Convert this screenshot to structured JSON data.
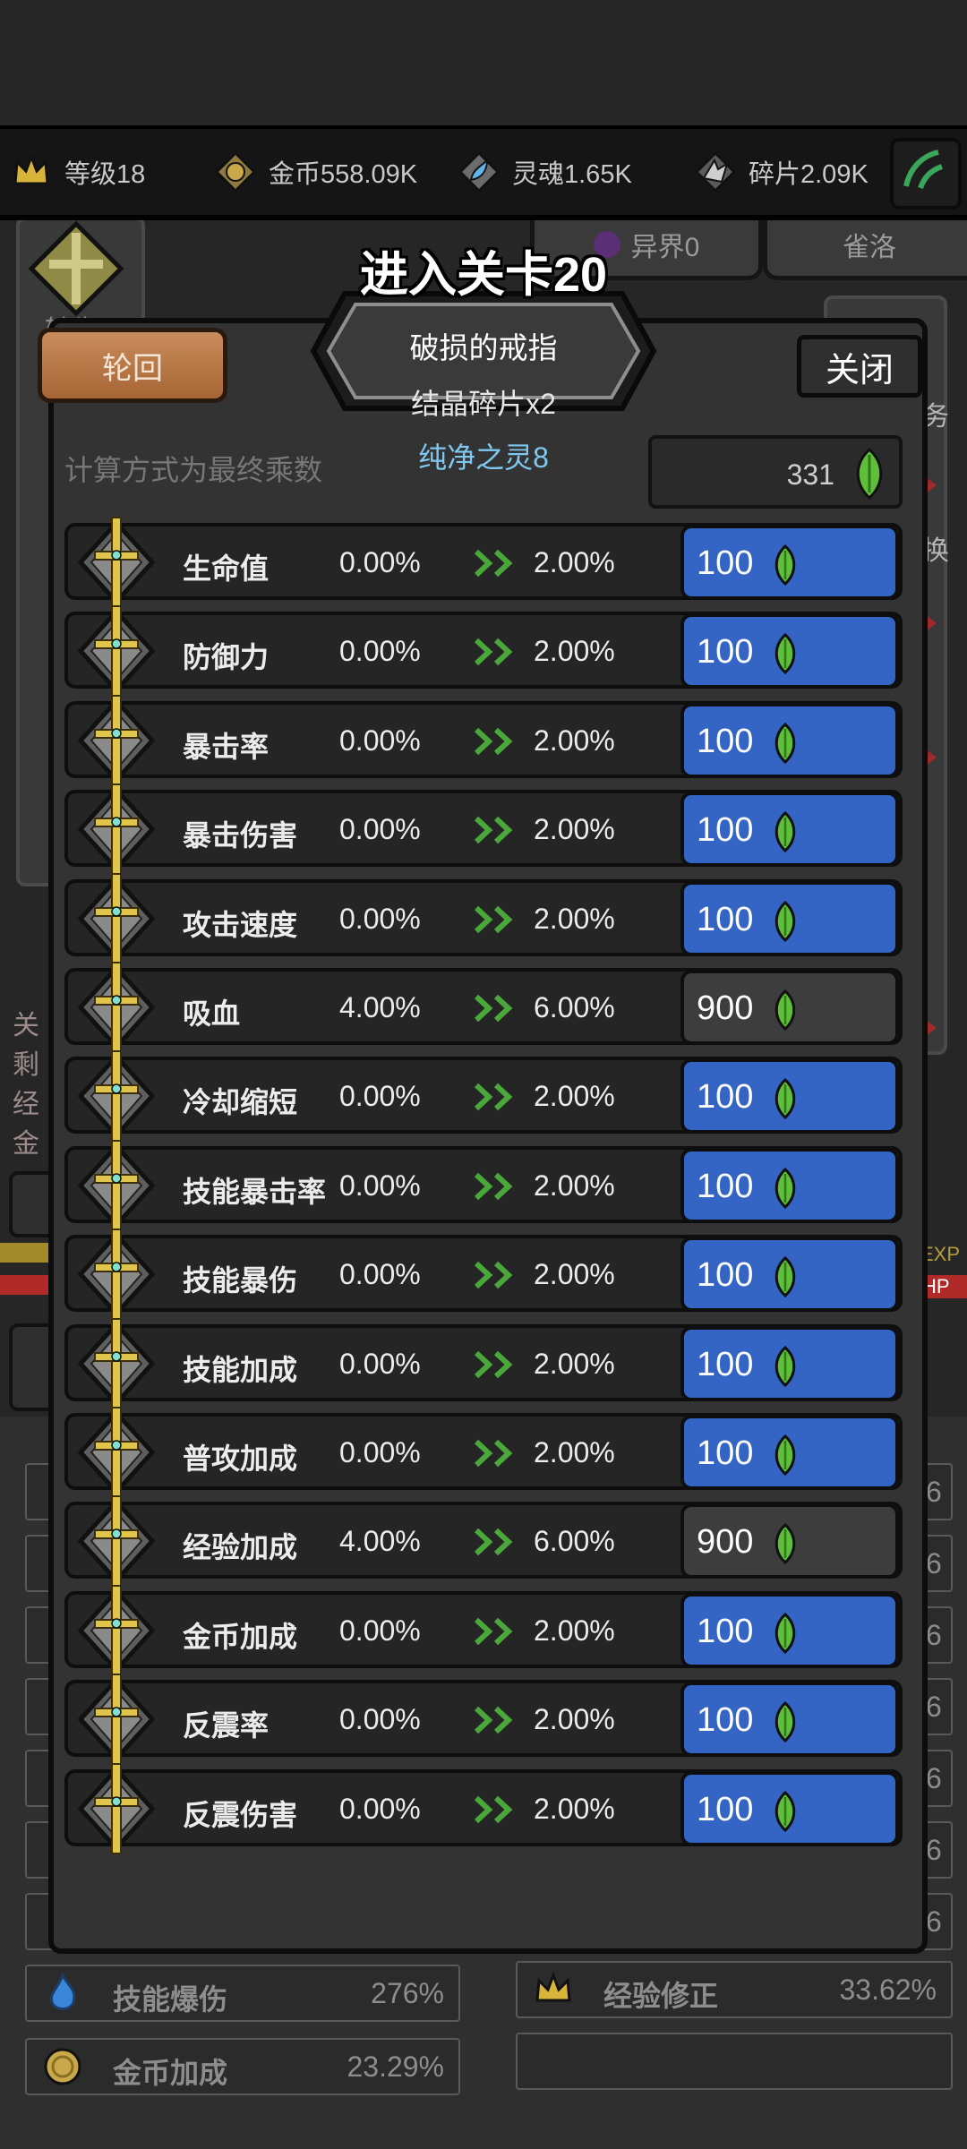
{
  "resources": [
    {
      "icon": "crown-icon",
      "label": "等级18"
    },
    {
      "icon": "gold-coin-icon",
      "label": "金币558.09K"
    },
    {
      "icon": "soul-icon",
      "label": "灵魂1.65K"
    },
    {
      "icon": "fragment-icon",
      "label": "碎片2.09K"
    }
  ],
  "background": {
    "tab_other_world": "异界0",
    "tab_right": "雀洛",
    "side_right_1": "务",
    "side_right_2": "换",
    "left_partial": [
      "关",
      "剩",
      "经",
      "金"
    ],
    "left_top_label": "转生",
    "exp_tag": "EXP",
    "hp_tag": "HP"
  },
  "modal": {
    "title": "进入关卡20",
    "item_name": "破损的戒指",
    "item_sub": "结晶碎片x2",
    "item_spirit": "纯净之灵8",
    "cycle_button": "轮回",
    "close_button": "关闭",
    "calc_hint": "计算方式为最终乘数",
    "balance": "331",
    "rows": [
      {
        "label": "生命值",
        "current": "0.00%",
        "next": "2.00%",
        "cost": "100",
        "state": "blue"
      },
      {
        "label": "防御力",
        "current": "0.00%",
        "next": "2.00%",
        "cost": "100",
        "state": "blue"
      },
      {
        "label": "暴击率",
        "current": "0.00%",
        "next": "2.00%",
        "cost": "100",
        "state": "blue"
      },
      {
        "label": "暴击伤害",
        "current": "0.00%",
        "next": "2.00%",
        "cost": "100",
        "state": "blue"
      },
      {
        "label": "攻击速度",
        "current": "0.00%",
        "next": "2.00%",
        "cost": "100",
        "state": "blue"
      },
      {
        "label": "吸血",
        "current": "4.00%",
        "next": "6.00%",
        "cost": "900",
        "state": "gray"
      },
      {
        "label": "冷却缩短",
        "current": "0.00%",
        "next": "2.00%",
        "cost": "100",
        "state": "blue"
      },
      {
        "label": "技能暴击率",
        "current": "0.00%",
        "next": "2.00%",
        "cost": "100",
        "state": "blue"
      },
      {
        "label": "技能暴伤",
        "current": "0.00%",
        "next": "2.00%",
        "cost": "100",
        "state": "blue"
      },
      {
        "label": "技能加成",
        "current": "0.00%",
        "next": "2.00%",
        "cost": "100",
        "state": "blue"
      },
      {
        "label": "普攻加成",
        "current": "0.00%",
        "next": "2.00%",
        "cost": "100",
        "state": "blue"
      },
      {
        "label": "经验加成",
        "current": "4.00%",
        "next": "6.00%",
        "cost": "900",
        "state": "gray"
      },
      {
        "label": "金币加成",
        "current": "0.00%",
        "next": "2.00%",
        "cost": "100",
        "state": "blue"
      },
      {
        "label": "反震率",
        "current": "0.00%",
        "next": "2.00%",
        "cost": "100",
        "state": "blue"
      },
      {
        "label": "反震伤害",
        "current": "0.00%",
        "next": "2.00%",
        "cost": "100",
        "state": "blue"
      }
    ]
  },
  "bottom_stats": [
    {
      "icon": "blue-flame-icon",
      "label": "技能爆伤",
      "value": "276%"
    },
    {
      "icon": "crown-icon",
      "label": "经验修正",
      "value": "33.62%"
    },
    {
      "icon": "gold-coin-icon",
      "label": "金币加成",
      "value": "23.29%"
    }
  ],
  "partial_right_values": [
    "6",
    "6",
    "6",
    "6",
    "6",
    "6",
    "6"
  ],
  "colors": {
    "accent_blue": "#3465c5",
    "disabled_gray": "#3d3d3d",
    "cycle_orange": "#b87443",
    "gem_green": "#5fbf3a",
    "spirit_blue": "#7ec8f0"
  }
}
